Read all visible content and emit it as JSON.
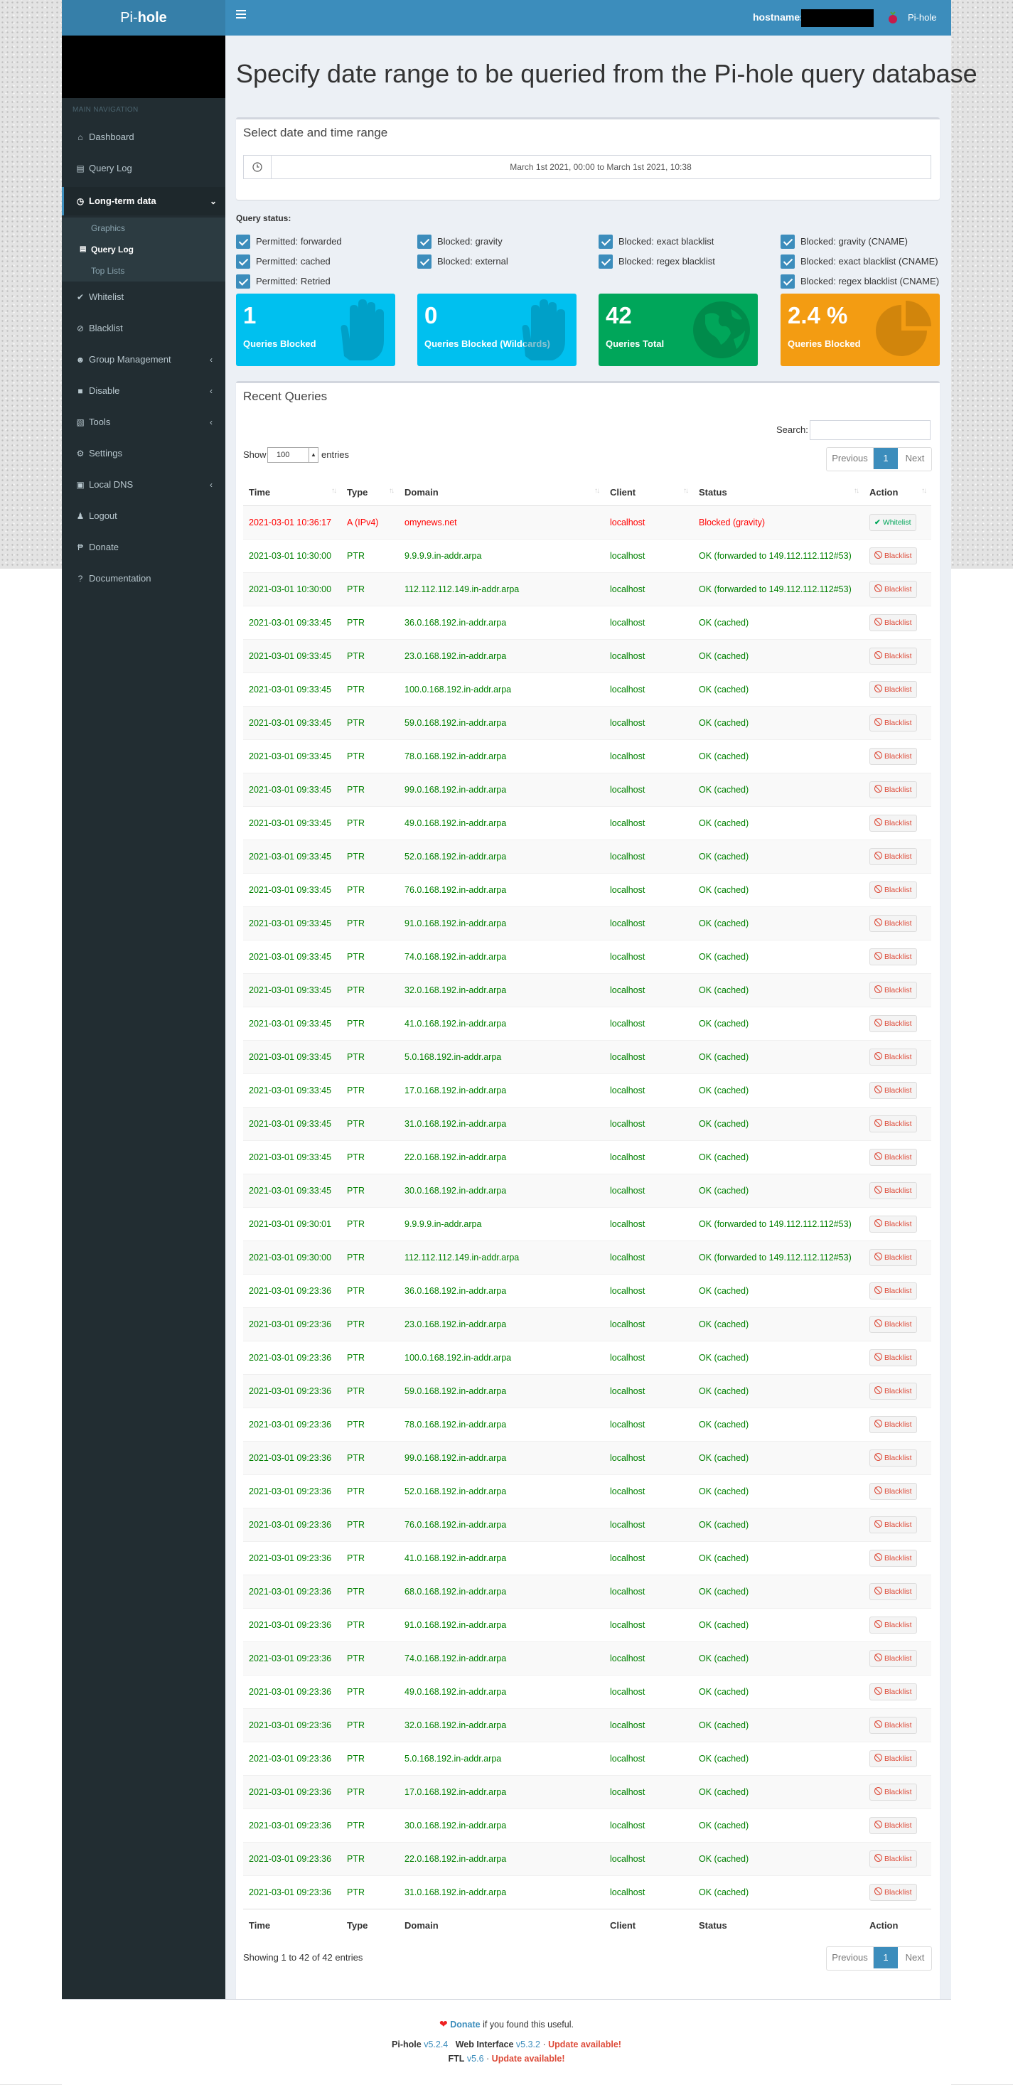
{
  "header": {
    "logo_light": "Pi-",
    "logo_bold": "hole",
    "hostname_label": "hostname:",
    "user_label": "Pi-hole"
  },
  "sidebar": {
    "header": "MAIN NAVIGATION",
    "items": [
      {
        "label": "Dashboard",
        "icon": "home-icon"
      },
      {
        "label": "Query Log",
        "icon": "file-icon"
      },
      {
        "label": "Long-term data",
        "icon": "history-icon"
      },
      {
        "label": "Whitelist",
        "icon": "check-circle-icon"
      },
      {
        "label": "Blacklist",
        "icon": "ban-icon"
      },
      {
        "label": "Group Management",
        "icon": "users-icon"
      },
      {
        "label": "Disable",
        "icon": "stop-icon"
      },
      {
        "label": "Tools",
        "icon": "folder-icon"
      },
      {
        "label": "Settings",
        "icon": "gears-icon"
      },
      {
        "label": "Local DNS",
        "icon": "address-book-icon"
      },
      {
        "label": "Logout",
        "icon": "user-times-icon"
      },
      {
        "label": "Donate",
        "icon": "paypal-icon"
      },
      {
        "label": "Documentation",
        "icon": "question-circle-icon"
      }
    ],
    "subitems": [
      {
        "label": "Graphics"
      },
      {
        "label": "Query Log"
      },
      {
        "label": "Top Lists"
      }
    ]
  },
  "page": {
    "title": "Specify date range to be queried from the Pi-hole query database"
  },
  "date_range": {
    "title": "Select date and time range",
    "value": "March 1st 2021, 00:00 to March 1st 2021, 10:38"
  },
  "query_status": {
    "label": "Query status:",
    "options": [
      {
        "label": "Permitted: forwarded",
        "checked": true
      },
      {
        "label": "Permitted: cached",
        "checked": true
      },
      {
        "label": "Permitted: Retried",
        "checked": true
      },
      {
        "label": "Blocked: gravity",
        "checked": true
      },
      {
        "label": "Blocked: external",
        "checked": true
      },
      {
        "label": "Blocked: exact blacklist",
        "checked": true
      },
      {
        "label": "Blocked: regex blacklist",
        "checked": true
      },
      {
        "label": "Blocked: gravity (CNAME)",
        "checked": true
      },
      {
        "label": "Blocked: exact blacklist (CNAME)",
        "checked": true
      },
      {
        "label": "Blocked: regex blacklist (CNAME)",
        "checked": true
      }
    ]
  },
  "stats": [
    {
      "value": "1",
      "label": "Queries Blocked",
      "color": "#00c0ef",
      "icon": "hand-icon"
    },
    {
      "value": "0",
      "label": "Queries Blocked (Wildcards)",
      "color": "#00c0ef",
      "icon": "hand-icon"
    },
    {
      "value": "42",
      "label": "Queries Total",
      "color": "#00a65a",
      "icon": "globe-icon"
    },
    {
      "value": "2.4 %",
      "label": "Queries Blocked",
      "color": "#f39c12",
      "icon": "pie-chart-icon"
    }
  ],
  "recent": {
    "title": "Recent Queries",
    "search_label": "Search:",
    "show_label": "Show",
    "length_value": "100",
    "entries_label": "entries",
    "pagination": {
      "previous": "Previous",
      "current": "1",
      "next": "Next"
    },
    "columns": [
      "Time",
      "Type",
      "Domain",
      "Client",
      "Status",
      "Action"
    ],
    "info": "Showing 1 to 42 of 42 entries",
    "rows": [
      {
        "time": "2021-03-01 10:36:17",
        "type": "A (IPv4)",
        "domain": "omynews.net",
        "client": "localhost",
        "status": "Blocked (gravity)",
        "action": "Whitelist",
        "blocked": true
      },
      {
        "time": "2021-03-01 10:30:00",
        "type": "PTR",
        "domain": "9.9.9.9.in-addr.arpa",
        "client": "localhost",
        "status": "OK (forwarded to 149.112.112.112#53)",
        "action": "Blacklist",
        "blocked": false
      },
      {
        "time": "2021-03-01 10:30:00",
        "type": "PTR",
        "domain": "112.112.112.149.in-addr.arpa",
        "client": "localhost",
        "status": "OK (forwarded to 149.112.112.112#53)",
        "action": "Blacklist",
        "blocked": false
      },
      {
        "time": "2021-03-01 09:33:45",
        "type": "PTR",
        "domain": "36.0.168.192.in-addr.arpa",
        "client": "localhost",
        "status": "OK (cached)",
        "action": "Blacklist",
        "blocked": false
      },
      {
        "time": "2021-03-01 09:33:45",
        "type": "PTR",
        "domain": "23.0.168.192.in-addr.arpa",
        "client": "localhost",
        "status": "OK (cached)",
        "action": "Blacklist",
        "blocked": false
      },
      {
        "time": "2021-03-01 09:33:45",
        "type": "PTR",
        "domain": "100.0.168.192.in-addr.arpa",
        "client": "localhost",
        "status": "OK (cached)",
        "action": "Blacklist",
        "blocked": false
      },
      {
        "time": "2021-03-01 09:33:45",
        "type": "PTR",
        "domain": "59.0.168.192.in-addr.arpa",
        "client": "localhost",
        "status": "OK (cached)",
        "action": "Blacklist",
        "blocked": false
      },
      {
        "time": "2021-03-01 09:33:45",
        "type": "PTR",
        "domain": "78.0.168.192.in-addr.arpa",
        "client": "localhost",
        "status": "OK (cached)",
        "action": "Blacklist",
        "blocked": false
      },
      {
        "time": "2021-03-01 09:33:45",
        "type": "PTR",
        "domain": "99.0.168.192.in-addr.arpa",
        "client": "localhost",
        "status": "OK (cached)",
        "action": "Blacklist",
        "blocked": false
      },
      {
        "time": "2021-03-01 09:33:45",
        "type": "PTR",
        "domain": "49.0.168.192.in-addr.arpa",
        "client": "localhost",
        "status": "OK (cached)",
        "action": "Blacklist",
        "blocked": false
      },
      {
        "time": "2021-03-01 09:33:45",
        "type": "PTR",
        "domain": "52.0.168.192.in-addr.arpa",
        "client": "localhost",
        "status": "OK (cached)",
        "action": "Blacklist",
        "blocked": false
      },
      {
        "time": "2021-03-01 09:33:45",
        "type": "PTR",
        "domain": "76.0.168.192.in-addr.arpa",
        "client": "localhost",
        "status": "OK (cached)",
        "action": "Blacklist",
        "blocked": false
      },
      {
        "time": "2021-03-01 09:33:45",
        "type": "PTR",
        "domain": "91.0.168.192.in-addr.arpa",
        "client": "localhost",
        "status": "OK (cached)",
        "action": "Blacklist",
        "blocked": false
      },
      {
        "time": "2021-03-01 09:33:45",
        "type": "PTR",
        "domain": "74.0.168.192.in-addr.arpa",
        "client": "localhost",
        "status": "OK (cached)",
        "action": "Blacklist",
        "blocked": false
      },
      {
        "time": "2021-03-01 09:33:45",
        "type": "PTR",
        "domain": "32.0.168.192.in-addr.arpa",
        "client": "localhost",
        "status": "OK (cached)",
        "action": "Blacklist",
        "blocked": false
      },
      {
        "time": "2021-03-01 09:33:45",
        "type": "PTR",
        "domain": "41.0.168.192.in-addr.arpa",
        "client": "localhost",
        "status": "OK (cached)",
        "action": "Blacklist",
        "blocked": false
      },
      {
        "time": "2021-03-01 09:33:45",
        "type": "PTR",
        "domain": "5.0.168.192.in-addr.arpa",
        "client": "localhost",
        "status": "OK (cached)",
        "action": "Blacklist",
        "blocked": false
      },
      {
        "time": "2021-03-01 09:33:45",
        "type": "PTR",
        "domain": "17.0.168.192.in-addr.arpa",
        "client": "localhost",
        "status": "OK (cached)",
        "action": "Blacklist",
        "blocked": false
      },
      {
        "time": "2021-03-01 09:33:45",
        "type": "PTR",
        "domain": "31.0.168.192.in-addr.arpa",
        "client": "localhost",
        "status": "OK (cached)",
        "action": "Blacklist",
        "blocked": false
      },
      {
        "time": "2021-03-01 09:33:45",
        "type": "PTR",
        "domain": "22.0.168.192.in-addr.arpa",
        "client": "localhost",
        "status": "OK (cached)",
        "action": "Blacklist",
        "blocked": false
      },
      {
        "time": "2021-03-01 09:33:45",
        "type": "PTR",
        "domain": "30.0.168.192.in-addr.arpa",
        "client": "localhost",
        "status": "OK (cached)",
        "action": "Blacklist",
        "blocked": false
      },
      {
        "time": "2021-03-01 09:30:01",
        "type": "PTR",
        "domain": "9.9.9.9.in-addr.arpa",
        "client": "localhost",
        "status": "OK (forwarded to 149.112.112.112#53)",
        "action": "Blacklist",
        "blocked": false
      },
      {
        "time": "2021-03-01 09:30:00",
        "type": "PTR",
        "domain": "112.112.112.149.in-addr.arpa",
        "client": "localhost",
        "status": "OK (forwarded to 149.112.112.112#53)",
        "action": "Blacklist",
        "blocked": false
      },
      {
        "time": "2021-03-01 09:23:36",
        "type": "PTR",
        "domain": "36.0.168.192.in-addr.arpa",
        "client": "localhost",
        "status": "OK (cached)",
        "action": "Blacklist",
        "blocked": false
      },
      {
        "time": "2021-03-01 09:23:36",
        "type": "PTR",
        "domain": "23.0.168.192.in-addr.arpa",
        "client": "localhost",
        "status": "OK (cached)",
        "action": "Blacklist",
        "blocked": false
      },
      {
        "time": "2021-03-01 09:23:36",
        "type": "PTR",
        "domain": "100.0.168.192.in-addr.arpa",
        "client": "localhost",
        "status": "OK (cached)",
        "action": "Blacklist",
        "blocked": false
      },
      {
        "time": "2021-03-01 09:23:36",
        "type": "PTR",
        "domain": "59.0.168.192.in-addr.arpa",
        "client": "localhost",
        "status": "OK (cached)",
        "action": "Blacklist",
        "blocked": false
      },
      {
        "time": "2021-03-01 09:23:36",
        "type": "PTR",
        "domain": "78.0.168.192.in-addr.arpa",
        "client": "localhost",
        "status": "OK (cached)",
        "action": "Blacklist",
        "blocked": false
      },
      {
        "time": "2021-03-01 09:23:36",
        "type": "PTR",
        "domain": "99.0.168.192.in-addr.arpa",
        "client": "localhost",
        "status": "OK (cached)",
        "action": "Blacklist",
        "blocked": false
      },
      {
        "time": "2021-03-01 09:23:36",
        "type": "PTR",
        "domain": "52.0.168.192.in-addr.arpa",
        "client": "localhost",
        "status": "OK (cached)",
        "action": "Blacklist",
        "blocked": false
      },
      {
        "time": "2021-03-01 09:23:36",
        "type": "PTR",
        "domain": "76.0.168.192.in-addr.arpa",
        "client": "localhost",
        "status": "OK (cached)",
        "action": "Blacklist",
        "blocked": false
      },
      {
        "time": "2021-03-01 09:23:36",
        "type": "PTR",
        "domain": "41.0.168.192.in-addr.arpa",
        "client": "localhost",
        "status": "OK (cached)",
        "action": "Blacklist",
        "blocked": false
      },
      {
        "time": "2021-03-01 09:23:36",
        "type": "PTR",
        "domain": "68.0.168.192.in-addr.arpa",
        "client": "localhost",
        "status": "OK (cached)",
        "action": "Blacklist",
        "blocked": false
      },
      {
        "time": "2021-03-01 09:23:36",
        "type": "PTR",
        "domain": "91.0.168.192.in-addr.arpa",
        "client": "localhost",
        "status": "OK (cached)",
        "action": "Blacklist",
        "blocked": false
      },
      {
        "time": "2021-03-01 09:23:36",
        "type": "PTR",
        "domain": "74.0.168.192.in-addr.arpa",
        "client": "localhost",
        "status": "OK (cached)",
        "action": "Blacklist",
        "blocked": false
      },
      {
        "time": "2021-03-01 09:23:36",
        "type": "PTR",
        "domain": "49.0.168.192.in-addr.arpa",
        "client": "localhost",
        "status": "OK (cached)",
        "action": "Blacklist",
        "blocked": false
      },
      {
        "time": "2021-03-01 09:23:36",
        "type": "PTR",
        "domain": "32.0.168.192.in-addr.arpa",
        "client": "localhost",
        "status": "OK (cached)",
        "action": "Blacklist",
        "blocked": false
      },
      {
        "time": "2021-03-01 09:23:36",
        "type": "PTR",
        "domain": "5.0.168.192.in-addr.arpa",
        "client": "localhost",
        "status": "OK (cached)",
        "action": "Blacklist",
        "blocked": false
      },
      {
        "time": "2021-03-01 09:23:36",
        "type": "PTR",
        "domain": "17.0.168.192.in-addr.arpa",
        "client": "localhost",
        "status": "OK (cached)",
        "action": "Blacklist",
        "blocked": false
      },
      {
        "time": "2021-03-01 09:23:36",
        "type": "PTR",
        "domain": "30.0.168.192.in-addr.arpa",
        "client": "localhost",
        "status": "OK (cached)",
        "action": "Blacklist",
        "blocked": false
      },
      {
        "time": "2021-03-01 09:23:36",
        "type": "PTR",
        "domain": "22.0.168.192.in-addr.arpa",
        "client": "localhost",
        "status": "OK (cached)",
        "action": "Blacklist",
        "blocked": false
      },
      {
        "time": "2021-03-01 09:23:36",
        "type": "PTR",
        "domain": "31.0.168.192.in-addr.arpa",
        "client": "localhost",
        "status": "OK (cached)",
        "action": "Blacklist",
        "blocked": false
      }
    ]
  },
  "footer": {
    "donate_link": "Donate",
    "donate_text": "if you found this useful.",
    "pihole_label": "Pi-hole",
    "pihole_version": "v5.2.4",
    "web_label": "Web Interface",
    "web_version": "v5.3.2",
    "ftl_label": "FTL",
    "ftl_version": "v5.6",
    "separator": "·",
    "update_text": "Update available!"
  },
  "colors": {
    "brand": "#3c8dbc",
    "sidebar": "#222d32",
    "ok": "#008000",
    "blocked": "#ff0000",
    "info": "#00c0ef",
    "success": "#00a65a",
    "warning": "#f39c12"
  }
}
